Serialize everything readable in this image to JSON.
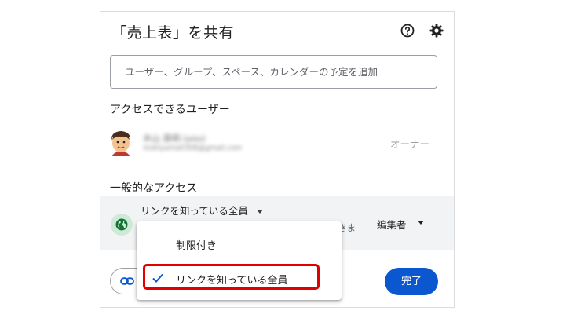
{
  "dialog": {
    "title": "「売上表」を共有",
    "help_icon": "help-circle-icon",
    "settings_icon": "gear-icon"
  },
  "add_people": {
    "placeholder": "ユーザー、グループ、スペース、カレンダーの予定を追加"
  },
  "people_with_access": {
    "heading": "アクセスできるユーザー",
    "owner": {
      "name": "木山 真明 (you)",
      "email": "mokiyama0308@gmail.com",
      "role": "オーナー",
      "avatar_icon": "avatar-illustration"
    }
  },
  "general_access": {
    "heading": "一般的なアクセス",
    "selected": "リンクを知っている全員",
    "partial_text": "きま",
    "role": "編集者",
    "globe_icon": "globe-icon",
    "options": [
      {
        "label": "制限付き",
        "selected": false
      },
      {
        "label": "リンクを知っている全員",
        "selected": true
      }
    ]
  },
  "footer": {
    "copy_link_icon": "link-icon",
    "done_label": "完了",
    "done_color": "#0b57d0"
  },
  "annotation": {
    "highlight_color": "#e00000"
  }
}
